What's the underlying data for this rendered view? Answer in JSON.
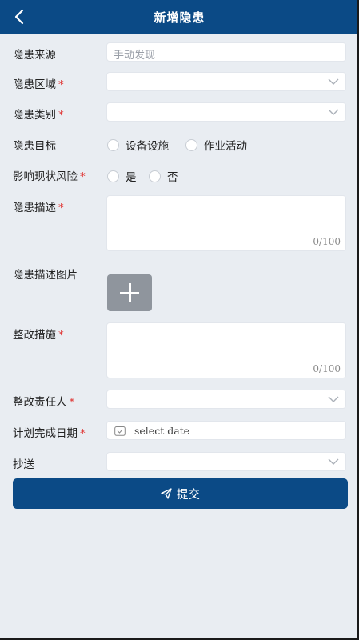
{
  "header": {
    "title": "新增隐患",
    "back_icon": "chevron-left-icon",
    "background": "#0b4a86"
  },
  "form": {
    "source": {
      "label": "隐患来源",
      "required": false,
      "value": "手动发现"
    },
    "area": {
      "label": "隐患区域",
      "required": true,
      "value": ""
    },
    "category": {
      "label": "隐患类别",
      "required": true,
      "value": ""
    },
    "target": {
      "label": "隐患目标",
      "required": false,
      "options": [
        "设备设施",
        "作业活动"
      ]
    },
    "risk": {
      "label": "影响现状风险",
      "required": true,
      "options": [
        "是",
        "否"
      ]
    },
    "description": {
      "label": "隐患描述",
      "required": true,
      "value": "",
      "counter": "0/100"
    },
    "images": {
      "label": "隐患描述图片",
      "required": false
    },
    "measures": {
      "label": "整改措施",
      "required": true,
      "value": "",
      "counter": "0/100"
    },
    "responsible": {
      "label": "整改责任人",
      "required": true,
      "value": ""
    },
    "due_date": {
      "label": "计划完成日期",
      "required": true,
      "placeholder": "select date"
    },
    "cc": {
      "label": "抄送",
      "required": false,
      "value": ""
    }
  },
  "submit": {
    "label": "提交",
    "icon": "send-icon"
  },
  "colors": {
    "required_mark": "#e0312f",
    "accent": "#0b4a86",
    "background": "#e9edf2"
  }
}
